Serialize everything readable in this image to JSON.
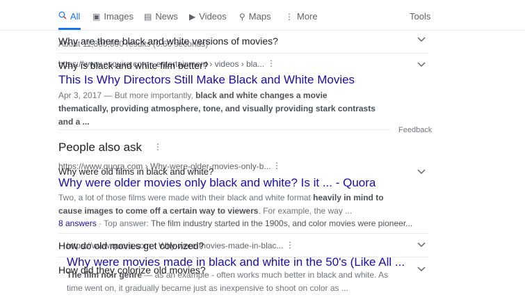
{
  "tabs": [
    {
      "label": "All",
      "icon": "search-icon"
    },
    {
      "label": "Images",
      "icon": "image-icon"
    },
    {
      "label": "News",
      "icon": "news-icon"
    },
    {
      "label": "Videos",
      "icon": "video-icon"
    },
    {
      "label": "Maps",
      "icon": "map-pin-icon"
    },
    {
      "label": "More",
      "icon": "more-vert-icon"
    }
  ],
  "tools": "Tools",
  "results_stats": "About 11,800,000 results (0.60 seconds)",
  "questions_top": [
    "Why are there black and white versions of movies?",
    "Why is black and white film better?"
  ],
  "result1": {
    "url": "https://www.esquire.com › entertainment › videos › bla...",
    "title": "This Is Why Directors Still Make Black and White Movies",
    "date": "Apr 3, 2017 — But more importantly, ",
    "bold": "black and white changes a movie thematically, providing atmosphere, tone, and visually providing stark contrasts and a ..."
  },
  "feedback": "Feedback",
  "paa_title": "People also ask",
  "questions_bottom": [
    "Why were old films in black and white?",
    "How do old movies get colorized?",
    "How did they colorize old movies?"
  ],
  "result2": {
    "url": "https://www.quora.com › Why-were-older-movies-only-b...",
    "title": "Why were older movies only black and white? Is it ... - Quora",
    "s1": "Two, a lot of those films were made with their black and white format ",
    "b1": "heavily in mind to cause images to come off a certain way to viewers",
    "s2": ". For example, the way ...",
    "answers": "8 answers",
    "top_label": " · Top answer: ",
    "top_text": "The film industry started in the 1900s, and color movies were pioneer..."
  },
  "result3": {
    "url": "https://www.quora.com › Why-were-movies-made-in-blac...",
    "title": "Why were movies made in black and white in the 50's (Like All ...",
    "b1": "The film noir genre",
    "s1": " — as an example - often works much better in black and white. As time went on, it gradually became just as inexpensive to shoot on color as ..."
  }
}
